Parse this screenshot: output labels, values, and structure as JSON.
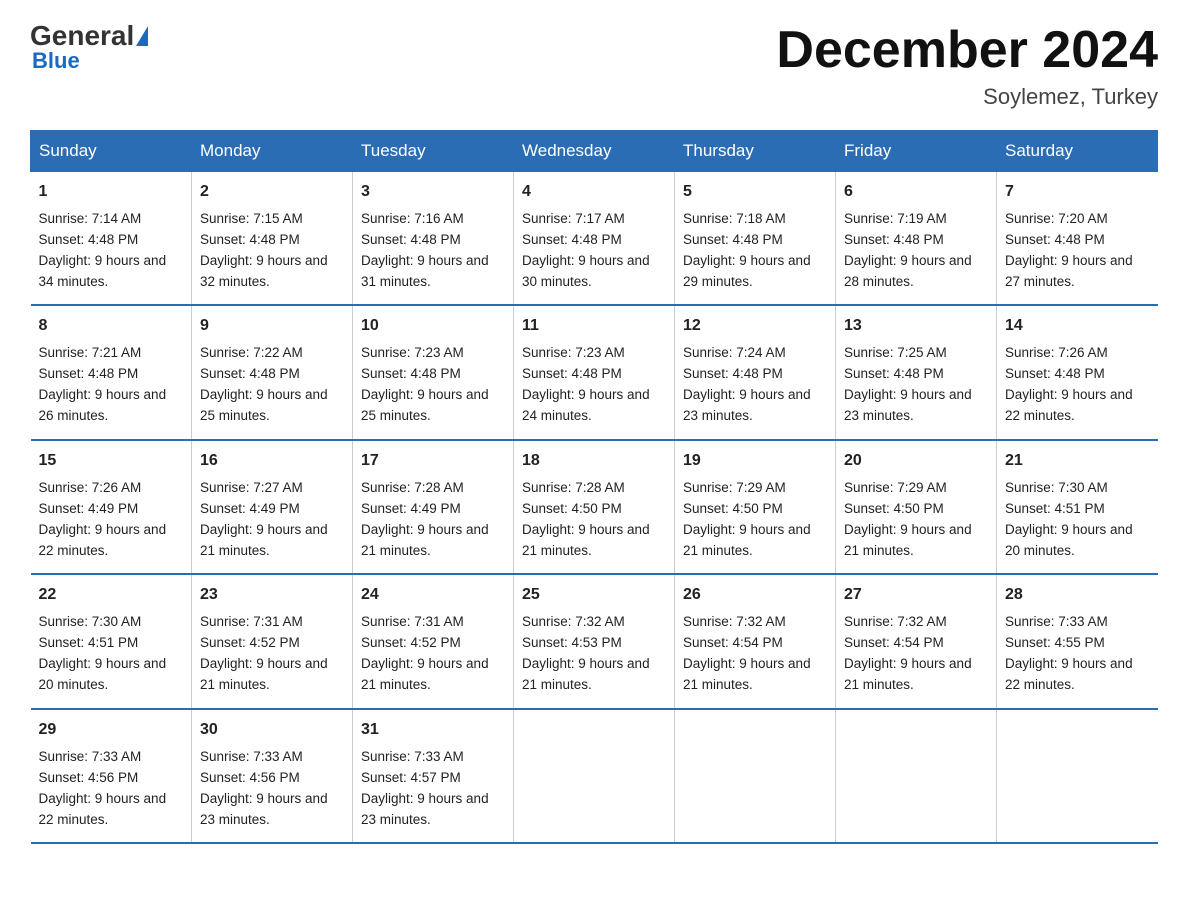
{
  "header": {
    "logo_general": "General",
    "logo_blue": "Blue",
    "month_title": "December 2024",
    "subtitle": "Soylemez, Turkey"
  },
  "days_of_week": [
    "Sunday",
    "Monday",
    "Tuesday",
    "Wednesday",
    "Thursday",
    "Friday",
    "Saturday"
  ],
  "weeks": [
    [
      {
        "day": "1",
        "sunrise": "7:14 AM",
        "sunset": "4:48 PM",
        "daylight": "9 hours and 34 minutes."
      },
      {
        "day": "2",
        "sunrise": "7:15 AM",
        "sunset": "4:48 PM",
        "daylight": "9 hours and 32 minutes."
      },
      {
        "day": "3",
        "sunrise": "7:16 AM",
        "sunset": "4:48 PM",
        "daylight": "9 hours and 31 minutes."
      },
      {
        "day": "4",
        "sunrise": "7:17 AM",
        "sunset": "4:48 PM",
        "daylight": "9 hours and 30 minutes."
      },
      {
        "day": "5",
        "sunrise": "7:18 AM",
        "sunset": "4:48 PM",
        "daylight": "9 hours and 29 minutes."
      },
      {
        "day": "6",
        "sunrise": "7:19 AM",
        "sunset": "4:48 PM",
        "daylight": "9 hours and 28 minutes."
      },
      {
        "day": "7",
        "sunrise": "7:20 AM",
        "sunset": "4:48 PM",
        "daylight": "9 hours and 27 minutes."
      }
    ],
    [
      {
        "day": "8",
        "sunrise": "7:21 AM",
        "sunset": "4:48 PM",
        "daylight": "9 hours and 26 minutes."
      },
      {
        "day": "9",
        "sunrise": "7:22 AM",
        "sunset": "4:48 PM",
        "daylight": "9 hours and 25 minutes."
      },
      {
        "day": "10",
        "sunrise": "7:23 AM",
        "sunset": "4:48 PM",
        "daylight": "9 hours and 25 minutes."
      },
      {
        "day": "11",
        "sunrise": "7:23 AM",
        "sunset": "4:48 PM",
        "daylight": "9 hours and 24 minutes."
      },
      {
        "day": "12",
        "sunrise": "7:24 AM",
        "sunset": "4:48 PM",
        "daylight": "9 hours and 23 minutes."
      },
      {
        "day": "13",
        "sunrise": "7:25 AM",
        "sunset": "4:48 PM",
        "daylight": "9 hours and 23 minutes."
      },
      {
        "day": "14",
        "sunrise": "7:26 AM",
        "sunset": "4:48 PM",
        "daylight": "9 hours and 22 minutes."
      }
    ],
    [
      {
        "day": "15",
        "sunrise": "7:26 AM",
        "sunset": "4:49 PM",
        "daylight": "9 hours and 22 minutes."
      },
      {
        "day": "16",
        "sunrise": "7:27 AM",
        "sunset": "4:49 PM",
        "daylight": "9 hours and 21 minutes."
      },
      {
        "day": "17",
        "sunrise": "7:28 AM",
        "sunset": "4:49 PM",
        "daylight": "9 hours and 21 minutes."
      },
      {
        "day": "18",
        "sunrise": "7:28 AM",
        "sunset": "4:50 PM",
        "daylight": "9 hours and 21 minutes."
      },
      {
        "day": "19",
        "sunrise": "7:29 AM",
        "sunset": "4:50 PM",
        "daylight": "9 hours and 21 minutes."
      },
      {
        "day": "20",
        "sunrise": "7:29 AM",
        "sunset": "4:50 PM",
        "daylight": "9 hours and 21 minutes."
      },
      {
        "day": "21",
        "sunrise": "7:30 AM",
        "sunset": "4:51 PM",
        "daylight": "9 hours and 20 minutes."
      }
    ],
    [
      {
        "day": "22",
        "sunrise": "7:30 AM",
        "sunset": "4:51 PM",
        "daylight": "9 hours and 20 minutes."
      },
      {
        "day": "23",
        "sunrise": "7:31 AM",
        "sunset": "4:52 PM",
        "daylight": "9 hours and 21 minutes."
      },
      {
        "day": "24",
        "sunrise": "7:31 AM",
        "sunset": "4:52 PM",
        "daylight": "9 hours and 21 minutes."
      },
      {
        "day": "25",
        "sunrise": "7:32 AM",
        "sunset": "4:53 PM",
        "daylight": "9 hours and 21 minutes."
      },
      {
        "day": "26",
        "sunrise": "7:32 AM",
        "sunset": "4:54 PM",
        "daylight": "9 hours and 21 minutes."
      },
      {
        "day": "27",
        "sunrise": "7:32 AM",
        "sunset": "4:54 PM",
        "daylight": "9 hours and 21 minutes."
      },
      {
        "day": "28",
        "sunrise": "7:33 AM",
        "sunset": "4:55 PM",
        "daylight": "9 hours and 22 minutes."
      }
    ],
    [
      {
        "day": "29",
        "sunrise": "7:33 AM",
        "sunset": "4:56 PM",
        "daylight": "9 hours and 22 minutes."
      },
      {
        "day": "30",
        "sunrise": "7:33 AM",
        "sunset": "4:56 PM",
        "daylight": "9 hours and 23 minutes."
      },
      {
        "day": "31",
        "sunrise": "7:33 AM",
        "sunset": "4:57 PM",
        "daylight": "9 hours and 23 minutes."
      },
      {
        "day": "",
        "sunrise": "",
        "sunset": "",
        "daylight": ""
      },
      {
        "day": "",
        "sunrise": "",
        "sunset": "",
        "daylight": ""
      },
      {
        "day": "",
        "sunrise": "",
        "sunset": "",
        "daylight": ""
      },
      {
        "day": "",
        "sunrise": "",
        "sunset": "",
        "daylight": ""
      }
    ]
  ]
}
